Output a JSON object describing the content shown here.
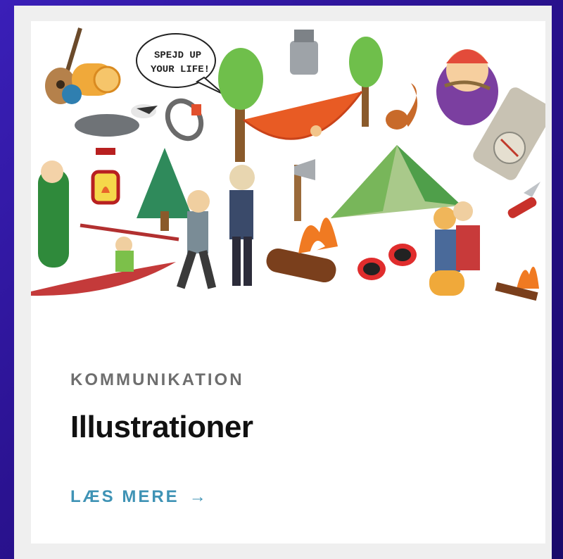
{
  "card": {
    "category": "KOMMUNIKATION",
    "title": "Illustrationer",
    "read_more": "LÆS MERE",
    "arrow_icon": "arrow-right-icon",
    "speech_bubble_text_line1": "SPEJD UP",
    "speech_bubble_text_line2": "YOUR LIFE!"
  },
  "colors": {
    "background": "#2a1290",
    "card": "#ffffff",
    "frame": "#efefef",
    "category": "#6e6e6e",
    "title": "#111111",
    "link": "#3f93b5"
  }
}
